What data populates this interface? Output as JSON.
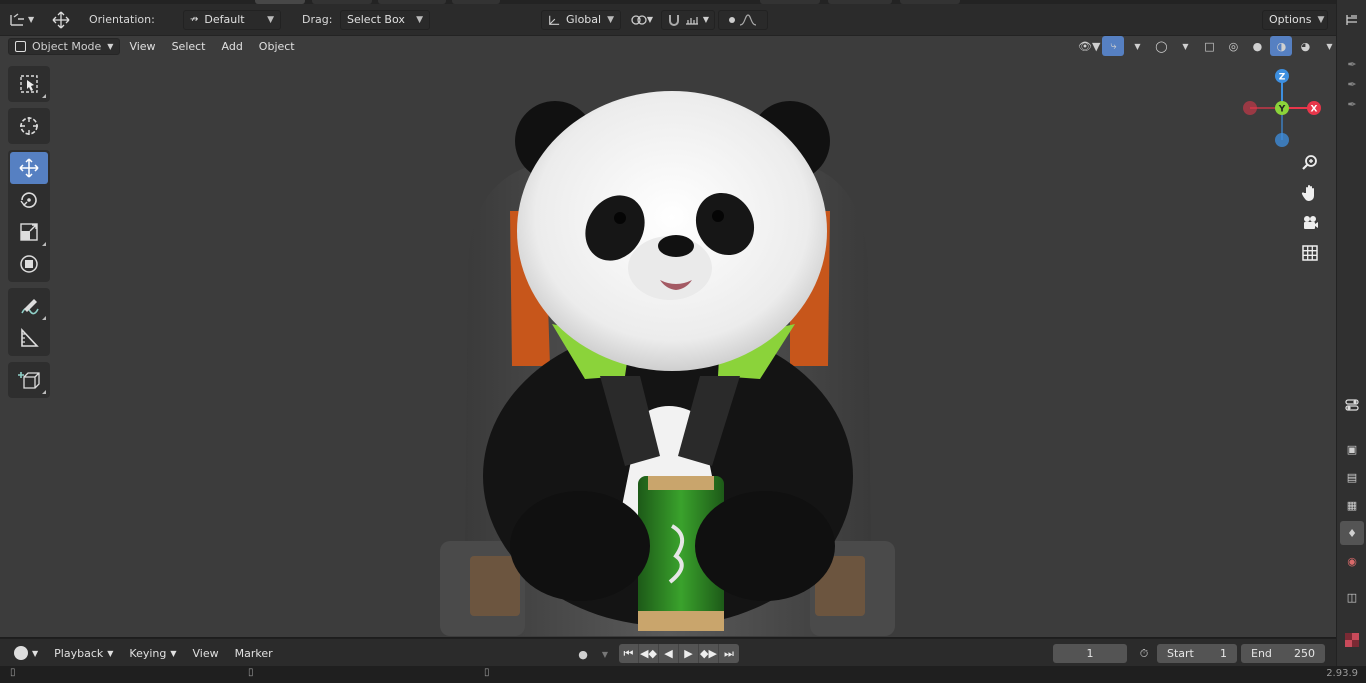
{
  "header": {
    "orientation_label": "Orientation:",
    "orientation_value": "Default",
    "drag_label": "Drag:",
    "drag_value": "Select Box",
    "transform_space": "Global",
    "options_label": "Options"
  },
  "viewport_menu": {
    "mode": "Object Mode",
    "items": [
      "View",
      "Select",
      "Add",
      "Object"
    ]
  },
  "gizmo": {
    "axes": [
      "Z",
      "Y",
      "X"
    ],
    "colors": {
      "x": "#e8364a",
      "y": "#8bd33a",
      "z": "#3d8fe0"
    }
  },
  "tools": [
    "select-box",
    "cursor",
    "move",
    "rotate",
    "scale",
    "transform",
    "annotate",
    "measure",
    "add-cube"
  ],
  "timeline": {
    "menus": [
      "Playback",
      "Keying",
      "View",
      "Marker"
    ],
    "current_frame": "1",
    "start_label": "Start",
    "start_value": "1",
    "end_label": "End",
    "end_value": "250"
  },
  "status": {
    "version": "2.93.9"
  },
  "colors": {
    "active_tool": "#5680c2",
    "viewport_bg": "#3c3c3c",
    "accent_green": "#8bd33a"
  }
}
